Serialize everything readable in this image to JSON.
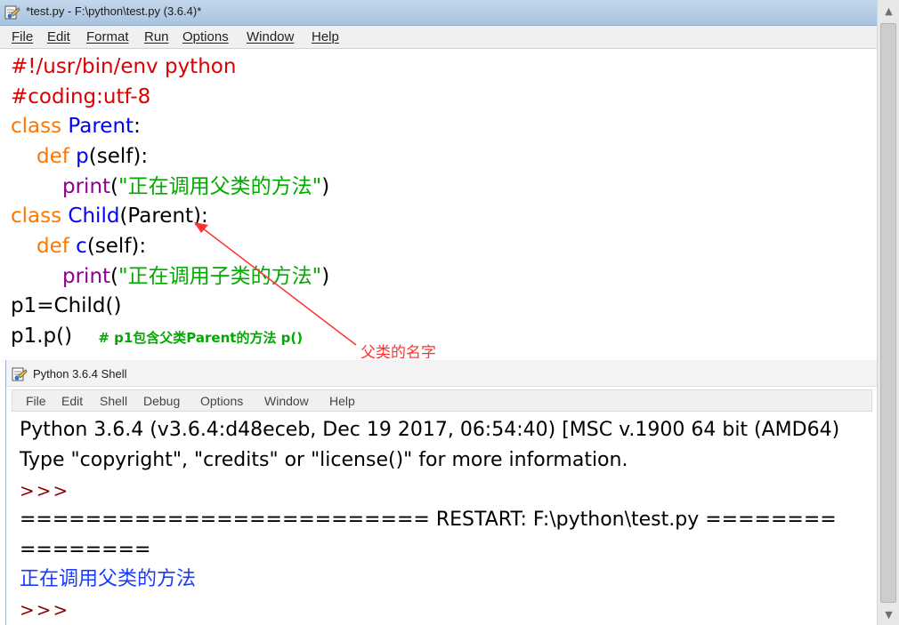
{
  "editor": {
    "title": "*test.py - F:\\python\\test.py (3.6.4)*",
    "menu": [
      "File",
      "Edit",
      "Format",
      "Run",
      "Options",
      "Window",
      "Help"
    ],
    "code": {
      "l1": "#!/usr/bin/env python",
      "l2": "#coding:utf-8",
      "l3": {
        "kw": "class",
        "name": "Parent",
        "rest": ":"
      },
      "l4": {
        "kw": "def",
        "name": "p",
        "rest": "(self):"
      },
      "l5": {
        "bi": "print",
        "open": "(",
        "str": "\"正在调用父类的方法\"",
        "close": ")"
      },
      "l6": {
        "kw": "class",
        "name": "Child",
        "rest": "(Parent):"
      },
      "l7": {
        "kw": "def",
        "name": "c",
        "rest": "(self):"
      },
      "l8": {
        "bi": "print",
        "open": "(",
        "str": "\"正在调用子类的方法\"",
        "close": ")"
      },
      "l9": "p1=Child()",
      "l10": {
        "code": "p1.p()",
        "comment": "# p1包含父类Parent的方法 p()"
      }
    },
    "annotation": "父类的名字"
  },
  "shell": {
    "title": "Python 3.6.4 Shell",
    "menu": [
      "File",
      "Edit",
      "Shell",
      "Debug",
      "Options",
      "Window",
      "Help"
    ],
    "output": {
      "banner": "Python 3.6.4 (v3.6.4:d48eceb, Dec 19 2017, 06:54:40) [MSC v.1900 64 bit (AMD64)",
      "info": "Type \"copyright\", \"credits\" or \"license()\" for more information.",
      "prompt1": ">>>",
      "restart": "========================= RESTART: F:\\python\\test.py ========",
      "restart_cont": "========",
      "stdout": "正在调用父类的方法",
      "prompt2": ">>>"
    }
  },
  "colors": {
    "keyword": "#ff7700",
    "definition": "#0000ff",
    "builtin": "#900090",
    "string": "#00aa00",
    "comment": "#dd0000",
    "stdout": "#1a3aff",
    "annotation": "#ff3030"
  },
  "icons": {
    "editor_app": "idle-icon",
    "shell_app": "idle-icon",
    "scroll_up": "scroll-up-arrow",
    "scroll_down": "scroll-down-arrow"
  }
}
